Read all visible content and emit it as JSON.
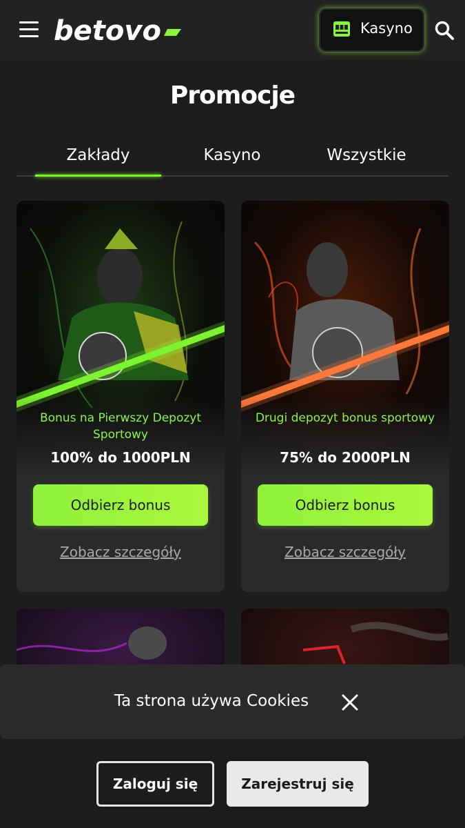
{
  "header": {
    "logo_text": "betovo",
    "casino_label": "Kasyno",
    "accent_color": "#8ff23b"
  },
  "page": {
    "title": "Promocje"
  },
  "tabs": [
    {
      "label": "Zakłady",
      "active": true
    },
    {
      "label": "Kasyno",
      "active": false
    },
    {
      "label": "Wszystkie",
      "active": false
    }
  ],
  "promos": [
    {
      "title": "Bonus na Pierwszy Depozyt Sportowy",
      "amount": "100% do 1000PLN",
      "claim_label": "Odbierz bonus",
      "details_label": "Zobacz szczegóły",
      "theme_color": "#6be02b"
    },
    {
      "title": "Drugi depozyt bonus sportowy",
      "amount": "75% do 2000PLN",
      "claim_label": "Odbierz bonus",
      "details_label": "Zobacz szczegóły",
      "theme_color": "#ff6a2b"
    }
  ],
  "cookie": {
    "text": "Ta strona używa Cookies"
  },
  "auth": {
    "login_label": "Zaloguj się",
    "register_label": "Zarejestruj się"
  }
}
